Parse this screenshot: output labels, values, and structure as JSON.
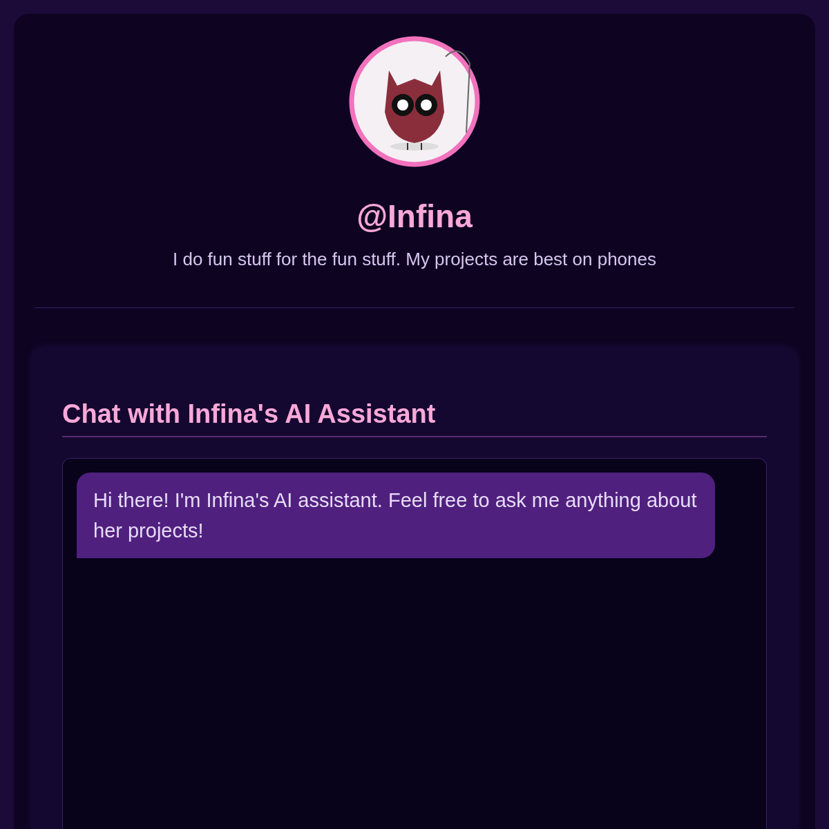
{
  "profile": {
    "name": "@Infina",
    "bio": "I do fun stuff for the fun stuff. My projects are best on phones"
  },
  "chat": {
    "title": "Chat with Infina's AI Assistant",
    "messages": [
      {
        "kind": "bot",
        "text": "Hi there! I'm Infina's AI assistant. Feel free to ask me anything about her projects!"
      }
    ]
  }
}
